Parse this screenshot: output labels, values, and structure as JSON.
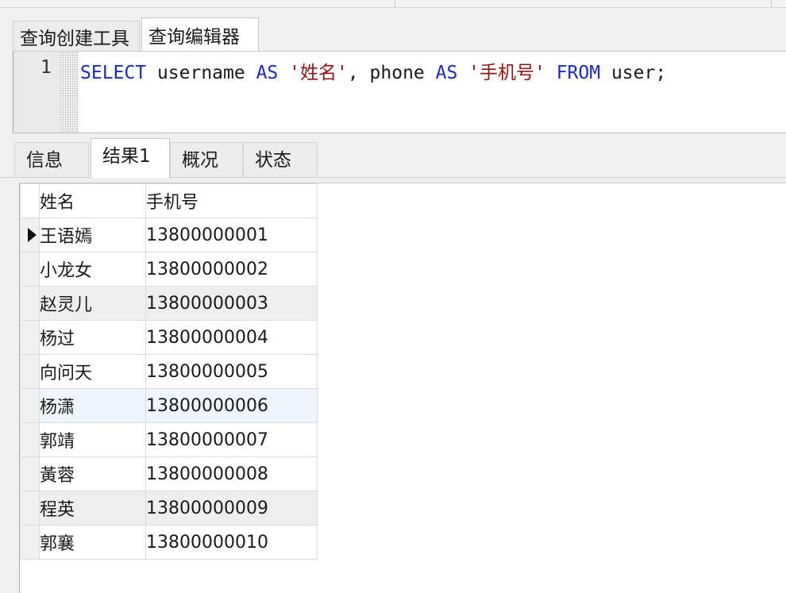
{
  "editor_tabs": [
    {
      "label": "查询创建工具",
      "active": false
    },
    {
      "label": "查询编辑器",
      "active": true
    }
  ],
  "editor": {
    "line_number": "1",
    "tokens": {
      "kw_select": "SELECT",
      "col_username": " username ",
      "kw_as1": "AS",
      "str_name": " '姓名'",
      "comma_phone": ", phone ",
      "kw_as2": "AS",
      "str_phone": " '手机号' ",
      "kw_from": "FROM",
      "table": " user;"
    }
  },
  "result_tabs": [
    {
      "label": "信息",
      "active": false
    },
    {
      "label": "结果1",
      "active": true
    },
    {
      "label": "概况",
      "active": false
    },
    {
      "label": "状态",
      "active": false
    }
  ],
  "grid": {
    "columns": [
      "姓名",
      "手机号"
    ],
    "rows": [
      {
        "name": "王语嫣",
        "phone": "13800000001"
      },
      {
        "name": "小龙女",
        "phone": "13800000002"
      },
      {
        "name": "赵灵儿",
        "phone": "13800000003"
      },
      {
        "name": "杨过",
        "phone": "13800000004"
      },
      {
        "name": "向问天",
        "phone": "13800000005"
      },
      {
        "name": "杨潇",
        "phone": "13800000006"
      },
      {
        "name": "郭靖",
        "phone": "13800000007"
      },
      {
        "name": "黃蓉",
        "phone": "13800000008"
      },
      {
        "name": "程英",
        "phone": "13800000009"
      },
      {
        "name": "郭襄",
        "phone": "13800000010"
      }
    ]
  },
  "colors": {
    "keyword": "#1c28d8",
    "string": "#9b1212",
    "header_selected": "#d9e8f6"
  }
}
